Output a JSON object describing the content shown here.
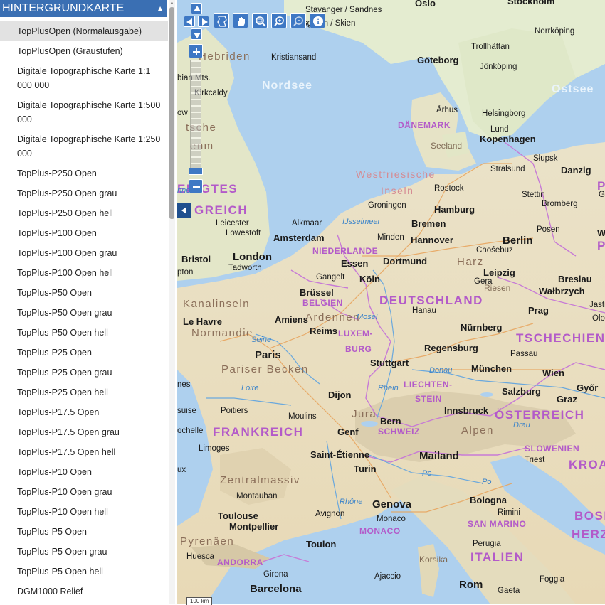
{
  "panel": {
    "title": "HINTERGRUNDKARTE",
    "collapse_icon": "caret-up-icon",
    "layers": [
      "TopPlusOpen (Normalausgabe)",
      "TopPlusOpen (Graustufen)",
      "Digitale Topographische Karte 1:1 000 000",
      "Digitale Topographische Karte 1:500 000",
      "Digitale Topographische Karte 1:250 000",
      "TopPlus-P250 Open",
      "TopPlus-P250 Open grau",
      "TopPlus-P250 Open hell",
      "TopPlus-P100 Open",
      "TopPlus-P100 Open grau",
      "TopPlus-P100 Open hell",
      "TopPlus-P50 Open",
      "TopPlus-P50 Open grau",
      "TopPlus-P50 Open hell",
      "TopPlus-P25 Open",
      "TopPlus-P25 Open grau",
      "TopPlus-P25 Open hell",
      "TopPlus-P17.5 Open",
      "TopPlus-P17.5 Open grau",
      "TopPlus-P17.5 Open hell",
      "TopPlus-P10 Open",
      "TopPlus-P10 Open grau",
      "TopPlus-P10 Open hell",
      "TopPlus-P5 Open",
      "TopPlus-P5 Open grau",
      "TopPlus-P5 Open hell",
      "DGM1000 Relief"
    ],
    "selected_index": 0
  },
  "toolbar": {
    "tools": [
      "map-extent-icon",
      "hand-pan-icon",
      "zoom-box-icon",
      "zoom-in-magnifier-icon",
      "zoom-out-magnifier-icon",
      "info-icon"
    ],
    "zoom_in": "+",
    "zoom_out": "−"
  },
  "scale": {
    "label": "100 km"
  },
  "map_labels": {
    "seas": [
      "Nordsee",
      "Ostsee"
    ],
    "countries": [
      "DÄNEMARK",
      "NIEDERLANDE",
      "BELGIEN",
      "LUXEM-",
      "BURG",
      "DEUTSCHLAND",
      "TSCHECHIEN",
      "LIECHTEN-",
      "STEIN",
      "SCHWEIZ",
      "ÖSTERREICH",
      "FRANKREICH",
      "SLOWENIEN",
      "KROATIE",
      "ITALIEN",
      "SAN MARINO",
      "MONACO",
      "ANDORRA",
      "BOSN",
      "HERZ",
      "ENIGTES",
      "GREICH",
      "P",
      "P"
    ],
    "regions": [
      "Westfriesische",
      "Inseln",
      "Kanalinseln",
      "Normandie",
      "Pariser Becken",
      "Zentralmassiv",
      "Alpen",
      "Pyrenäen",
      "Ardennen",
      "Harz",
      "Riesen",
      "Jura",
      "Hebriden",
      "bian Mts.",
      "tsche",
      "enm"
    ],
    "islands": [
      "Seeland",
      "Korsika"
    ],
    "rivers": [
      "Seine",
      "Loire",
      "Rhein",
      "Donau",
      "Drau",
      "Mosel",
      "Po",
      "Po",
      "Rhône",
      "IJsselmeer",
      "nnes"
    ],
    "cities": [
      "Oslo",
      "Stavanger / Sandnes",
      "Stockholm",
      "Porsgrunn / Skien",
      "Norrköping",
      "Trollhättan",
      "Kristiansand",
      "Göteborg",
      "Jönköping",
      "Kirkcaldy",
      "Århus",
      "Helsingborg",
      "Lund",
      "Kopenhagen",
      "Słupsk",
      "Danzig",
      "Stralsund",
      "Rostock",
      "Stettin",
      "Grudz",
      "Bromberg",
      "Groningen",
      "Hamburg",
      "Leicester",
      "Lowestoft",
      "Alkmaar",
      "Amsterdam",
      "Bremen",
      "Minden",
      "Posen",
      "Hannover",
      "Berlin",
      "Chośebuz",
      "Bristol",
      "London",
      "Tadworth",
      "Essen",
      "Dortmund",
      "Leipzig",
      "Breslau",
      "Gangelt",
      "Köln",
      "Gera",
      "Wałbrzych",
      "Brüssel",
      "Hanau",
      "Prag",
      "Jastrzęb",
      "Le Havre",
      "Amiens",
      "Olom",
      "Reims",
      "Nürnberg",
      "Paris",
      "Regensburg",
      "Passau",
      "Stuttgart",
      "München",
      "Wien",
      "Dijon",
      "Salzburg",
      "Graz",
      "Győr",
      "Poitiers",
      "Moulins",
      "Bern",
      "Innsbruck",
      "Genf",
      "Limoges",
      "Saint-Étienne",
      "Mailand",
      "Triest",
      "Turin",
      "Bologna",
      "Montauban",
      "Genova",
      "Toulouse",
      "Avignon",
      "Rimini",
      "Montpellier",
      "Monaco",
      "Perugia",
      "Toulon",
      "Huesca",
      "Girona",
      "Ajaccio",
      "Barcelona",
      "Rom",
      "Gaeta",
      "Foggia",
      "pton",
      "nes",
      "suise",
      "ochelle",
      "ux",
      "ow",
      "W"
    ]
  }
}
